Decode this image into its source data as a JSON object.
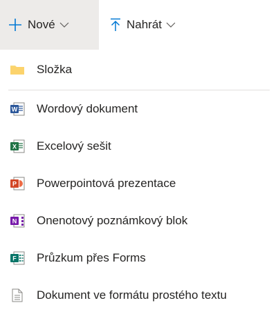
{
  "toolbar": {
    "new_label": "Nové",
    "upload_label": "Nahrát"
  },
  "menu": {
    "items": [
      {
        "label": "Složka",
        "icon": "folder-icon"
      },
      {
        "label": "Wordový dokument",
        "icon": "word-icon"
      },
      {
        "label": "Excelový sešit",
        "icon": "excel-icon"
      },
      {
        "label": "Powerpointová prezentace",
        "icon": "powerpoint-icon"
      },
      {
        "label": "Onenotový poznámkový blok",
        "icon": "onenote-icon"
      },
      {
        "label": "Průzkum přes Forms",
        "icon": "forms-icon"
      },
      {
        "label": "Dokument ve formátu prostého textu",
        "icon": "text-file-icon"
      }
    ]
  },
  "colors": {
    "accent": "#0078d4",
    "folder": "#f8d775",
    "word": "#2b579a",
    "excel": "#217346",
    "powerpoint": "#d24726",
    "onenote": "#7719aa",
    "forms": "#077568"
  }
}
